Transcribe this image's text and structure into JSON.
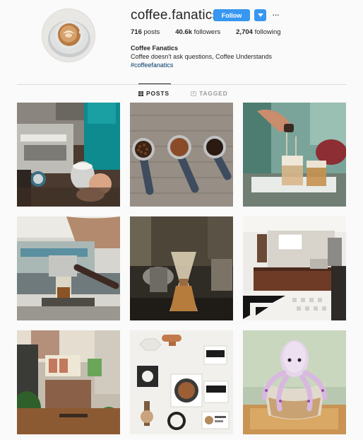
{
  "profile": {
    "username": "coffee.fanatics",
    "follow_label": "Follow",
    "more_label": "···",
    "full_name": "Coffee Fanatics",
    "bio": "Coffee doesn't ask questions, Coffee Understands",
    "hashtag": "#coffeefanatics"
  },
  "stats": {
    "posts_count": "716",
    "posts_label": "posts",
    "followers_count": "40.6k",
    "followers_label": "followers",
    "following_count": "2,704",
    "following_label": "following"
  },
  "tabs": [
    {
      "label": "POSTS",
      "active": true,
      "icon": "grid-icon"
    },
    {
      "label": "TAGGED",
      "active": false,
      "icon": "tag-icon"
    }
  ],
  "colors": {
    "accent": "#3897f0",
    "text": "#262626",
    "muted": "#999999",
    "hashtag": "#003569",
    "background": "#fafafa"
  },
  "posts": [
    {
      "subject": "espresso-machine-milk-pitcher"
    },
    {
      "subject": "three-portafilters-on-wood"
    },
    {
      "subject": "pour-over-iced-coffee"
    },
    {
      "subject": "espresso-extraction"
    },
    {
      "subject": "chemex-brewer"
    },
    {
      "subject": "coffee-shop-interior"
    },
    {
      "subject": "loft-cafe-interior"
    },
    {
      "subject": "coffee-flatlay"
    },
    {
      "subject": "octopus-latte-art-cup"
    }
  ]
}
